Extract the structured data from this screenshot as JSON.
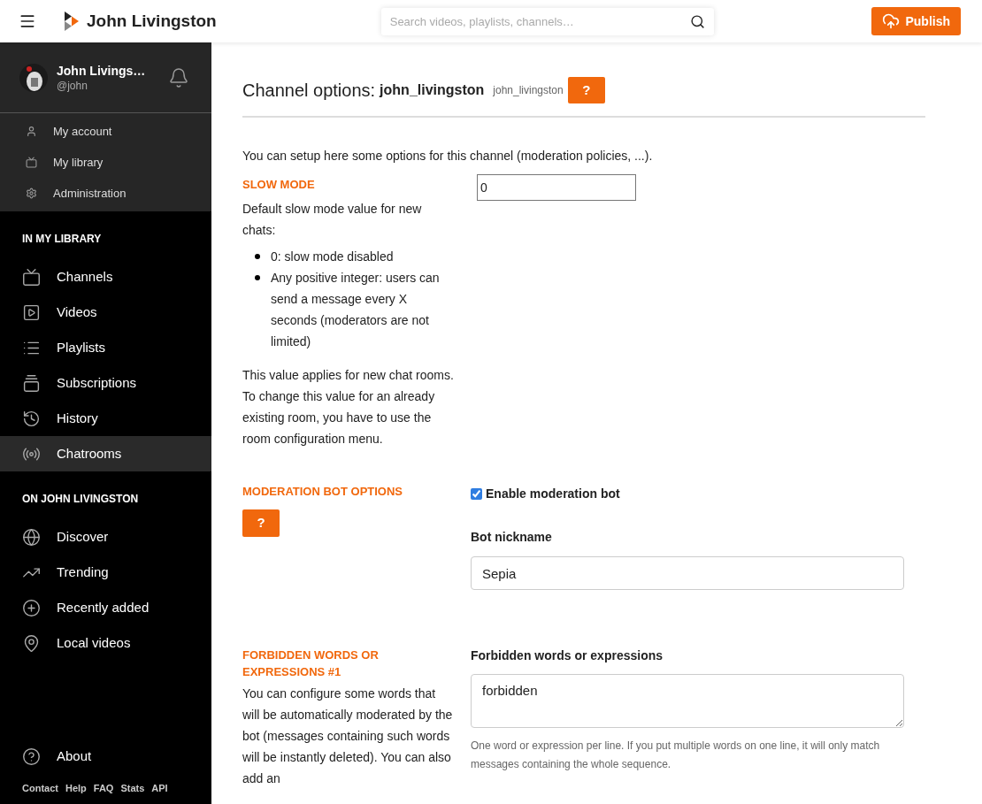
{
  "header": {
    "site_title": "John Livingston",
    "search": {
      "placeholder": "Search videos, playlists, channels…"
    },
    "publish": "Publish"
  },
  "sidebar": {
    "user": {
      "name": "John Livings…",
      "handle": "@john"
    },
    "user_menu": [
      {
        "label": "My account"
      },
      {
        "label": "My library"
      },
      {
        "label": "Administration"
      }
    ],
    "sections": [
      {
        "title": "IN MY LIBRARY",
        "items": [
          {
            "label": "Channels",
            "selected": false
          },
          {
            "label": "Videos",
            "selected": false
          },
          {
            "label": "Playlists",
            "selected": false
          },
          {
            "label": "Subscriptions",
            "selected": false
          },
          {
            "label": "History",
            "selected": false
          },
          {
            "label": "Chatrooms",
            "selected": true
          }
        ]
      },
      {
        "title": "ON JOHN LIVINGSTON",
        "items": [
          {
            "label": "Discover",
            "selected": false
          },
          {
            "label": "Trending",
            "selected": false
          },
          {
            "label": "Recently added",
            "selected": false
          },
          {
            "label": "Local videos",
            "selected": false
          }
        ]
      }
    ],
    "about": "About",
    "footer_links": [
      "Contact",
      "Help",
      "FAQ",
      "Stats",
      "API"
    ]
  },
  "page": {
    "title": "Channel options:",
    "channel": "john_livingston",
    "handle": "john_livingston",
    "help": "?",
    "intro": "You can setup here some options for this channel (moderation policies, ...).",
    "slow_mode": {
      "title": "SLOW MODE",
      "description": "Default slow mode value for new chats:",
      "bullets": [
        "0: slow mode disabled",
        "Any positive integer: users can send a message every X seconds (moderators are not limited)"
      ],
      "note": "This value applies for new chat rooms. To change this value for an already existing room, you have to use the room configuration menu.",
      "value": "0"
    },
    "moderation_bot": {
      "title": "MODERATION BOT OPTIONS",
      "help": "?",
      "enable": {
        "label": "Enable moderation bot",
        "checked": true
      },
      "nickname": {
        "label": "Bot nickname",
        "value": "Sepia"
      }
    },
    "forbidden": {
      "title": "FORBIDDEN WORDS OR EXPRESSIONS #1",
      "description": "You can configure some words that will be automatically moderated by the bot (messages containing such words will be instantly deleted). You can also add an",
      "label": "Forbidden words or expressions",
      "value": "forbidden",
      "hint": "One word or expression per line. If you put multiple words on one line, it will only match messages containing the whole sequence."
    }
  }
}
